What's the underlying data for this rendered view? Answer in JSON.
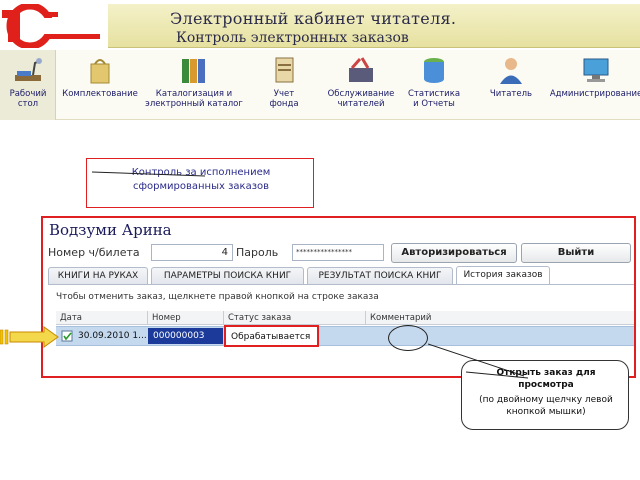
{
  "header": {
    "title_line1": "Электронный кабинет читателя.",
    "title_line2": "Контроль электронных заказов"
  },
  "toolbar": {
    "items": [
      {
        "label": "Рабочий\nстол",
        "icon": "desktop-lamp-icon"
      },
      {
        "label": "Комплектование",
        "icon": "shopping-bag-icon"
      },
      {
        "label": "Каталогизация и\nэлектронный каталог",
        "icon": "binders-icon"
      },
      {
        "label": "Учет\nфонда",
        "icon": "book-icon"
      },
      {
        "label": "Обслуживание\nчитателей",
        "icon": "toolbox-icon"
      },
      {
        "label": "Статистика\nи Отчеты",
        "icon": "database-icon"
      },
      {
        "label": "Читатель",
        "icon": "person-icon"
      },
      {
        "label": "Администрирование",
        "icon": "computer-icon"
      }
    ]
  },
  "callout1": {
    "text": "Контроль за исполнением сформированных заказов"
  },
  "form": {
    "user_name": "Водзуми Арина",
    "card_label": "Номер ч/билета",
    "card_value": "4",
    "password_label": "Пароль",
    "password_value": "****************",
    "login_button": "Авторизироваться",
    "exit_button": "Выйти"
  },
  "tabs": [
    {
      "label": "КНИГИ НА РУКАХ"
    },
    {
      "label": "ПАРАМЕТРЫ ПОИСКА КНИГ"
    },
    {
      "label": "РЕЗУЛЬТАТ ПОИСКА КНИГ"
    },
    {
      "label": "История заказов",
      "active": true
    }
  ],
  "hint": "Чтобы отменить заказ, щелкнете правой кнопкой на строке заказа",
  "table": {
    "columns": [
      "Дата",
      "Номер",
      "Статус заказа",
      "Комментарий"
    ],
    "rows": [
      {
        "date": "30.09.2010 1...",
        "number": "000000003",
        "status": "Обрабатывается",
        "comment": ""
      }
    ]
  },
  "callout2": {
    "title": "Открыть заказ для просмотра",
    "subtitle": "(по двойному щелчку левой кнопкой мышки)"
  },
  "colors": {
    "accent_red": "#e02020",
    "selection_blue": "#c4d8ee",
    "number_highlight": "#1b3a9a",
    "header_band": "#e6e1a0"
  }
}
